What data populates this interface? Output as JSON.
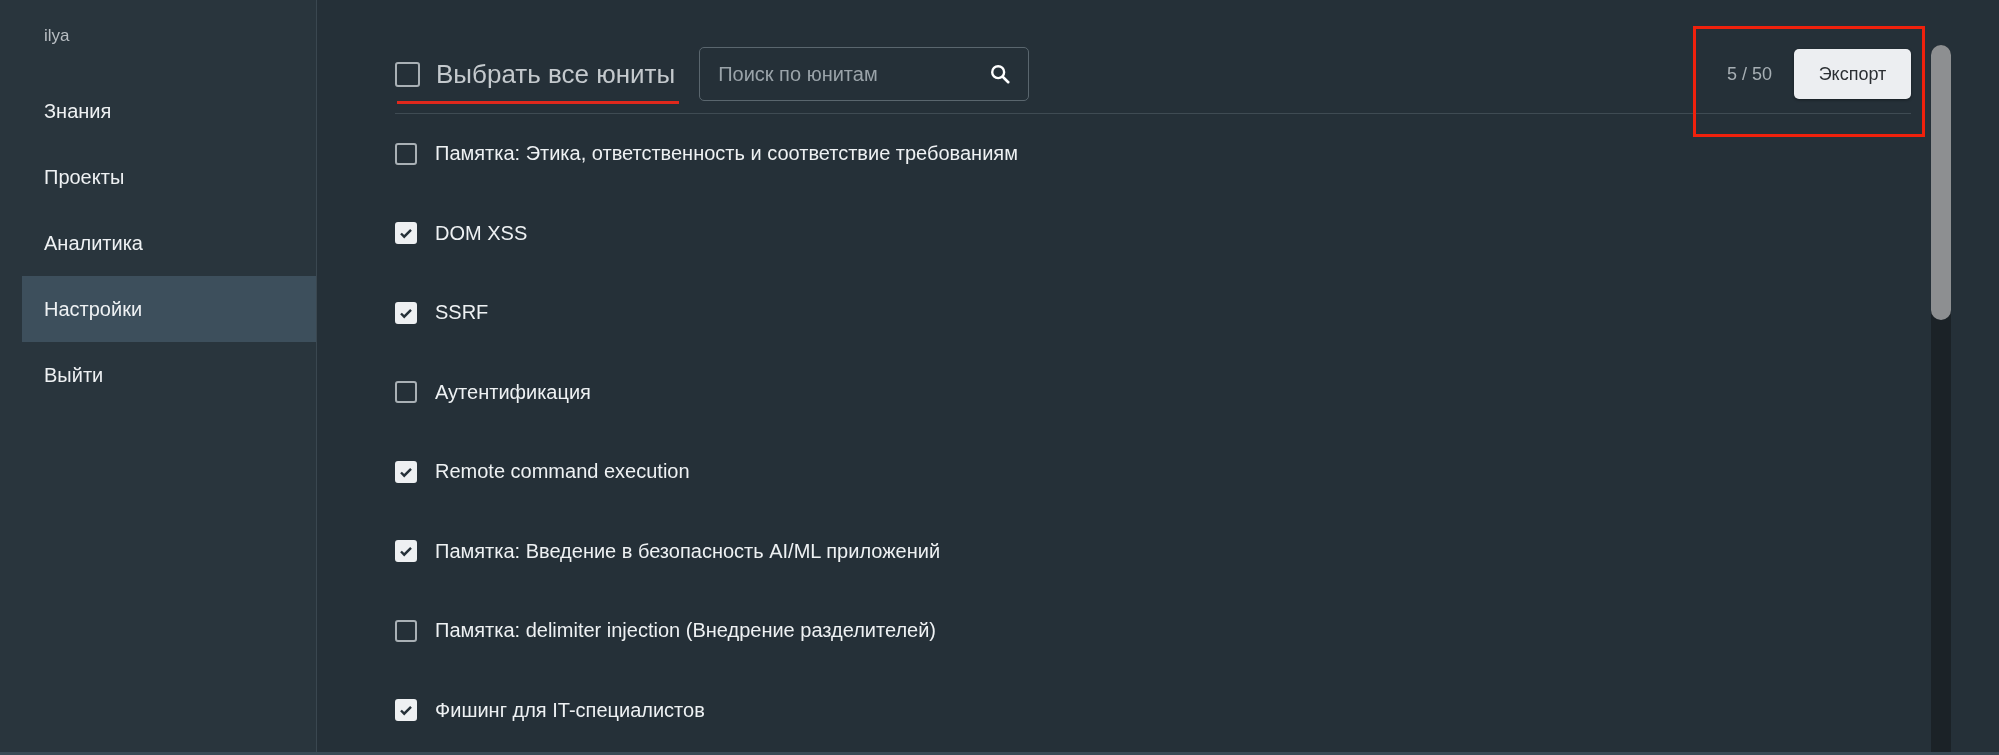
{
  "sidebar": {
    "user": "ilya",
    "items": [
      {
        "label": "Знания",
        "selected": false
      },
      {
        "label": "Проекты",
        "selected": false
      },
      {
        "label": "Аналитика",
        "selected": false
      },
      {
        "label": "Настройки",
        "selected": true
      },
      {
        "label": "Выйти",
        "selected": false
      }
    ]
  },
  "toolbar": {
    "select_all": {
      "label": "Выбрать все юниты",
      "checked": false,
      "underlined": true
    },
    "search": {
      "placeholder": "Поиск по юнитам"
    },
    "counter": "5 / 50",
    "export_button": "Экспорт",
    "counter_highlighted": true
  },
  "units": [
    {
      "label": "Памятка: Этика, ответственность и соответствие требованиям",
      "checked": false
    },
    {
      "label": "DOM XSS",
      "checked": true
    },
    {
      "label": "SSRF",
      "checked": true
    },
    {
      "label": "Аутентификация",
      "checked": false
    },
    {
      "label": "Remote command execution",
      "checked": true
    },
    {
      "label": "Памятка: Введение в безопасность AI/ML приложений",
      "checked": true
    },
    {
      "label": "Памятка: delimiter injection (Внедрение разделителей)",
      "checked": false
    },
    {
      "label": "Фишинг для IT-специалистов",
      "checked": true
    }
  ]
}
